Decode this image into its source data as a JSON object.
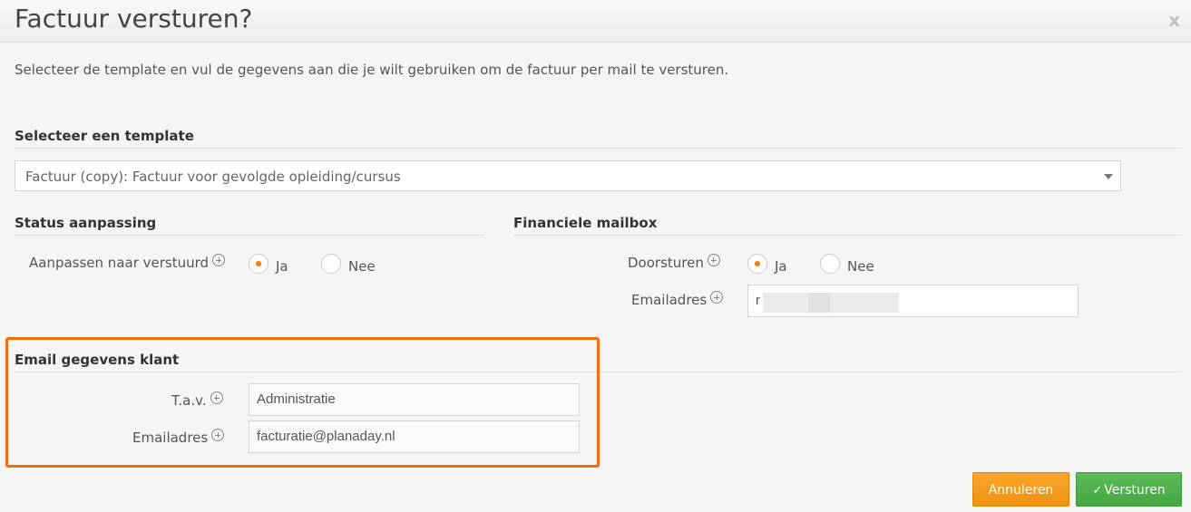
{
  "dialog": {
    "title": "Factuur versturen?",
    "close_label": "x",
    "intro": "Selecteer de template en vul de gegevens aan die je wilt gebruiken om de factuur per mail te versturen."
  },
  "template_section": {
    "title": "Selecteer een template",
    "selected_value": "Factuur (copy): Factuur voor gevolgde opleiding/cursus"
  },
  "status_section": {
    "title": "Status aanpassing",
    "field_label": "Aanpassen naar verstuurd",
    "option_yes": "Ja",
    "option_no": "Nee",
    "selected": "Ja"
  },
  "mailbox_section": {
    "title": "Financiele mailbox",
    "forward_label": "Doorsturen",
    "option_yes": "Ja",
    "option_no": "Nee",
    "selected": "Ja",
    "email_label": "Emailadres",
    "email_value": "r"
  },
  "client_section": {
    "title": "Email gegevens klant",
    "attention_label": "T.a.v.",
    "attention_value": "Administratie",
    "email_label": "Emailadres",
    "email_value": "facturatie@planaday.nl"
  },
  "footer": {
    "cancel_label": "Annuleren",
    "send_label": "Versturen",
    "send_icon": "check-icon"
  },
  "colors": {
    "accent_orange": "#f07c00",
    "highlight_border": "#f26d0f",
    "cancel_button": "#f9a72c",
    "send_button": "#4fb14c"
  }
}
